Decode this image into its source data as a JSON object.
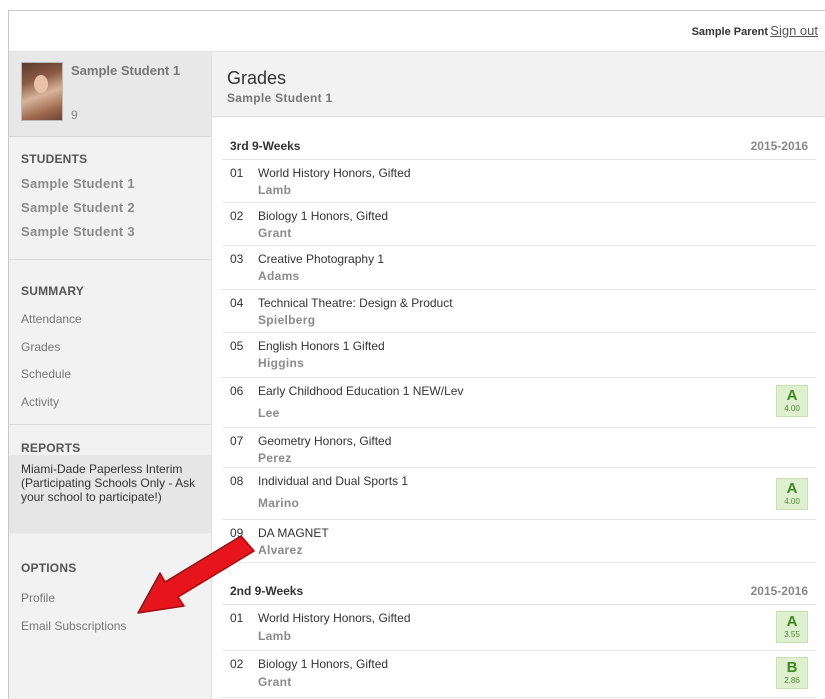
{
  "topbar": {
    "parent_name": "Sample Parent",
    "signout": "Sign out"
  },
  "profile": {
    "name": "Sample Student 1",
    "grade": "9"
  },
  "sidebar": {
    "students_heading": "STUDENTS",
    "students": [
      "Sample Student 1",
      "Sample Student 2",
      "Sample Student 3"
    ],
    "summary_heading": "SUMMARY",
    "summary_links": [
      "Attendance",
      "Grades",
      "Schedule",
      "Activity"
    ],
    "reports_heading": "REPORTS",
    "reports_text": "Miami-Dade Paperless Interim (Participating Schools Only - Ask your school to participate!)",
    "options_heading": "OPTIONS",
    "options_links": [
      "Profile",
      "Email Subscriptions"
    ]
  },
  "main": {
    "title": "Grades",
    "subtitle": "Sample Student 1"
  },
  "sections": [
    {
      "title": "3rd 9-Weeks",
      "year": "2015-2016",
      "courses": [
        {
          "period": "01",
          "name": "World History Honors, Gifted",
          "teacher": "Lamb"
        },
        {
          "period": "02",
          "name": "Biology 1 Honors, Gifted",
          "teacher": "Grant"
        },
        {
          "period": "03",
          "name": "Creative Photography 1",
          "teacher": "Adams"
        },
        {
          "period": "04",
          "name": "Technical Theatre: Design & Product",
          "teacher": "Spielberg"
        },
        {
          "period": "05",
          "name": "English Honors 1 Gifted",
          "teacher": "Higgins"
        },
        {
          "period": "06",
          "name": "Early Childhood Education 1 NEW/Lev",
          "teacher": "Lee",
          "grade": "A",
          "points": "4.00"
        },
        {
          "period": "07",
          "name": "Geometry Honors, Gifted",
          "teacher": "Perez"
        },
        {
          "period": "08",
          "name": "Individual and Dual Sports 1",
          "teacher": "Marino",
          "grade": "A",
          "points": "4.00"
        },
        {
          "period": "09",
          "name": "DA MAGNET",
          "teacher": "Alvarez"
        }
      ]
    },
    {
      "title": "2nd 9-Weeks",
      "year": "2015-2016",
      "courses": [
        {
          "period": "01",
          "name": "World History Honors, Gifted",
          "teacher": "Lamb",
          "grade": "A",
          "points": "3.55"
        },
        {
          "period": "02",
          "name": "Biology 1 Honors, Gifted",
          "teacher": "Grant",
          "grade": "B",
          "points": "2.86"
        }
      ]
    }
  ],
  "colors": {
    "grade_bg": "#dff0d0",
    "grade_text": "#3d8a1d",
    "arrow": "#e8141c"
  }
}
